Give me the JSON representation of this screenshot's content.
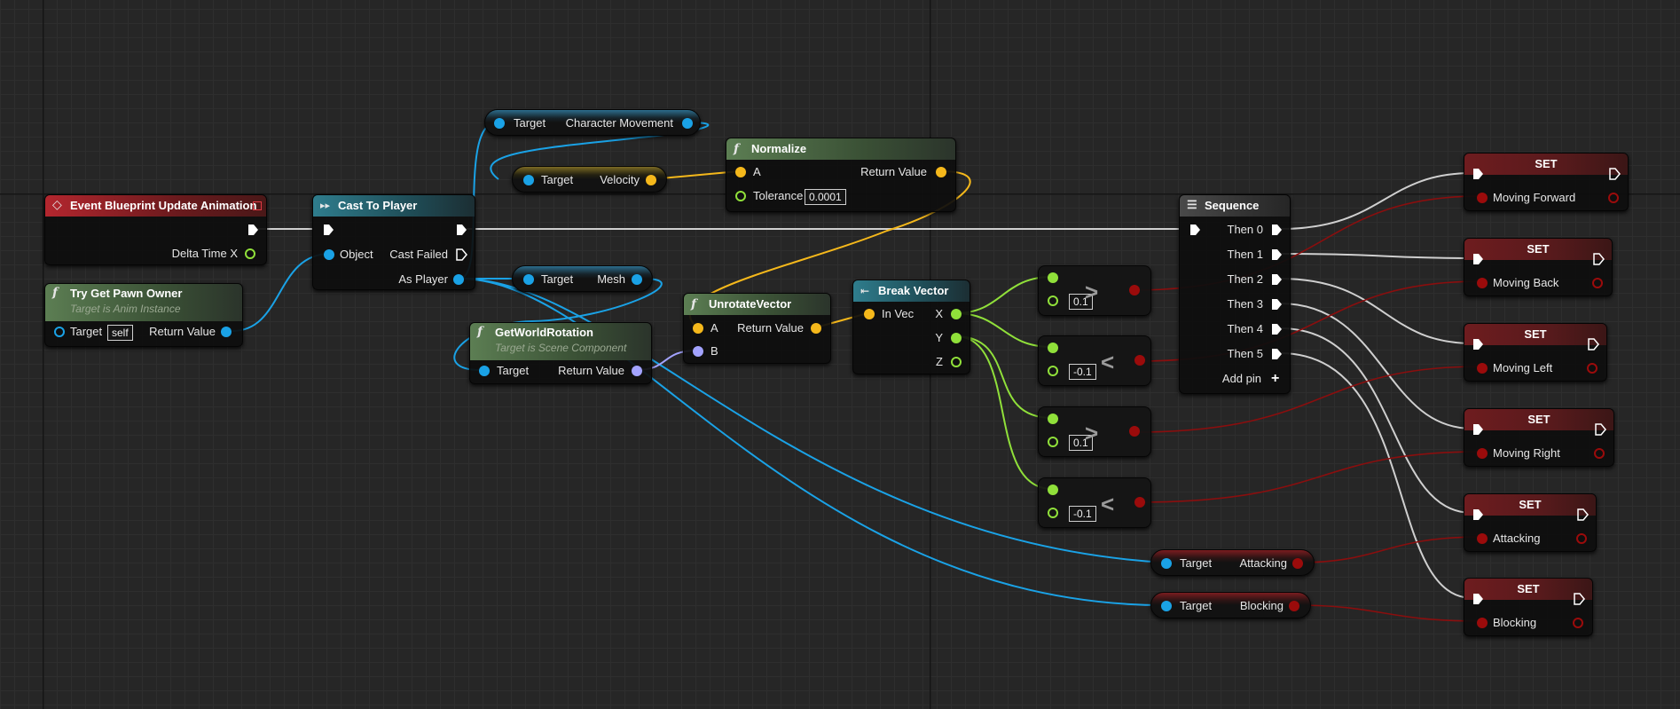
{
  "colors": {
    "exec_wire": "#cfcfcf",
    "object_pin": "#1aa2e6",
    "vector_pin": "#f5b81b",
    "float_pin": "#90e03a",
    "rotator_pin": "#a3a3ff",
    "bool_pin": "#9b0b0b"
  },
  "nodes": {
    "event_update": {
      "title": "Event Blueprint Update Animation",
      "icon": "event-diamond-icon",
      "out_delta": "Delta Time X"
    },
    "try_get_pawn": {
      "title": "Try Get Pawn Owner",
      "subtitle": "Target is Anim Instance",
      "icon": "function-icon",
      "in_target": "Target",
      "target_value": "self",
      "out_return": "Return Value"
    },
    "cast_to_player": {
      "title": "Cast To Player",
      "icon": "cast-icon",
      "in_object": "Object",
      "out_cast_failed": "Cast Failed",
      "out_as_player": "As Player"
    },
    "get_char_movement": {
      "in_target": "Target",
      "out": "Character Movement"
    },
    "get_velocity": {
      "in_target": "Target",
      "out": "Velocity"
    },
    "get_mesh": {
      "in_target": "Target",
      "out": "Mesh"
    },
    "normalize": {
      "title": "Normalize",
      "icon": "function-icon",
      "in_a": "A",
      "in_tolerance": "Tolerance",
      "tolerance_value": "0.0001",
      "out_return": "Return Value"
    },
    "get_world_rotation": {
      "title": "GetWorldRotation",
      "subtitle": "Target is Scene Component",
      "icon": "function-icon",
      "in_target": "Target",
      "out_return": "Return Value"
    },
    "unrotate_vector": {
      "title": "UnrotateVector",
      "icon": "function-icon",
      "in_a": "A",
      "in_b": "B",
      "out_return": "Return Value"
    },
    "break_vector": {
      "title": "Break Vector",
      "icon": "break-struct-icon",
      "in_vec": "In Vec",
      "out_x": "X",
      "out_y": "Y",
      "out_z": "Z"
    },
    "compare": [
      {
        "symbol": ">",
        "value": "0.1"
      },
      {
        "symbol": "<",
        "value": "-0.1"
      },
      {
        "symbol": ">",
        "value": "0.1"
      },
      {
        "symbol": "<",
        "value": "-0.1"
      }
    ],
    "sequence": {
      "title": "Sequence",
      "icon": "sequence-icon",
      "outs": [
        "Then 0",
        "Then 1",
        "Then 2",
        "Then 3",
        "Then 4",
        "Then 5"
      ],
      "add_pin": "Add pin"
    },
    "get_attacking": {
      "in_target": "Target",
      "out": "Attacking"
    },
    "get_blocking": {
      "in_target": "Target",
      "out": "Blocking"
    },
    "sets": [
      {
        "title": "SET",
        "var": "Moving Forward"
      },
      {
        "title": "SET",
        "var": "Moving Back"
      },
      {
        "title": "SET",
        "var": "Moving Left"
      },
      {
        "title": "SET",
        "var": "Moving Right"
      },
      {
        "title": "SET",
        "var": "Attacking"
      },
      {
        "title": "SET",
        "var": "Blocking"
      }
    ]
  }
}
